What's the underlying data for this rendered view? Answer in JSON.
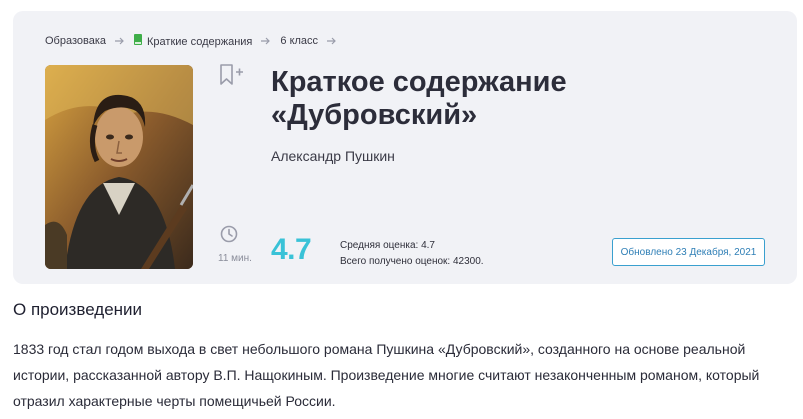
{
  "breadcrumb": {
    "items": [
      {
        "label": "Образовака"
      },
      {
        "label": "Краткие содержания"
      },
      {
        "label": "6 класс"
      }
    ]
  },
  "book": {
    "title_line1": "Краткое содержание",
    "title_line2": "«Дубровский»",
    "author": "Александр Пушкин",
    "cover_icon": "book-cover-portrait"
  },
  "reading_time": "11 мин.",
  "rating": {
    "value": "4.7",
    "average_label": "Средняя оценка: 4.7",
    "total_label": "Всего получено оценок: 42300."
  },
  "updated_label": "Обновлено 23 Декабря, 2021",
  "about": {
    "heading": "О произведении",
    "text": "1833 год стал годом выхода в свет небольшого романа Пушкина «Дубровский», созданного на основе реальной истории, рассказанной автору В.П. Нащокиным. Произведение многие считают незаконченным романом, который отразил характерные черты помещичьей России."
  },
  "colors": {
    "card_bg": "#f1f2f6",
    "rating_accent": "#39c2d7",
    "updated_border": "#3aa0cf",
    "breadcrumb_book_icon": "#3fae49"
  },
  "icons": [
    "arrow-right-icon",
    "book-icon",
    "bookmark-plus-icon",
    "clock-icon"
  ]
}
